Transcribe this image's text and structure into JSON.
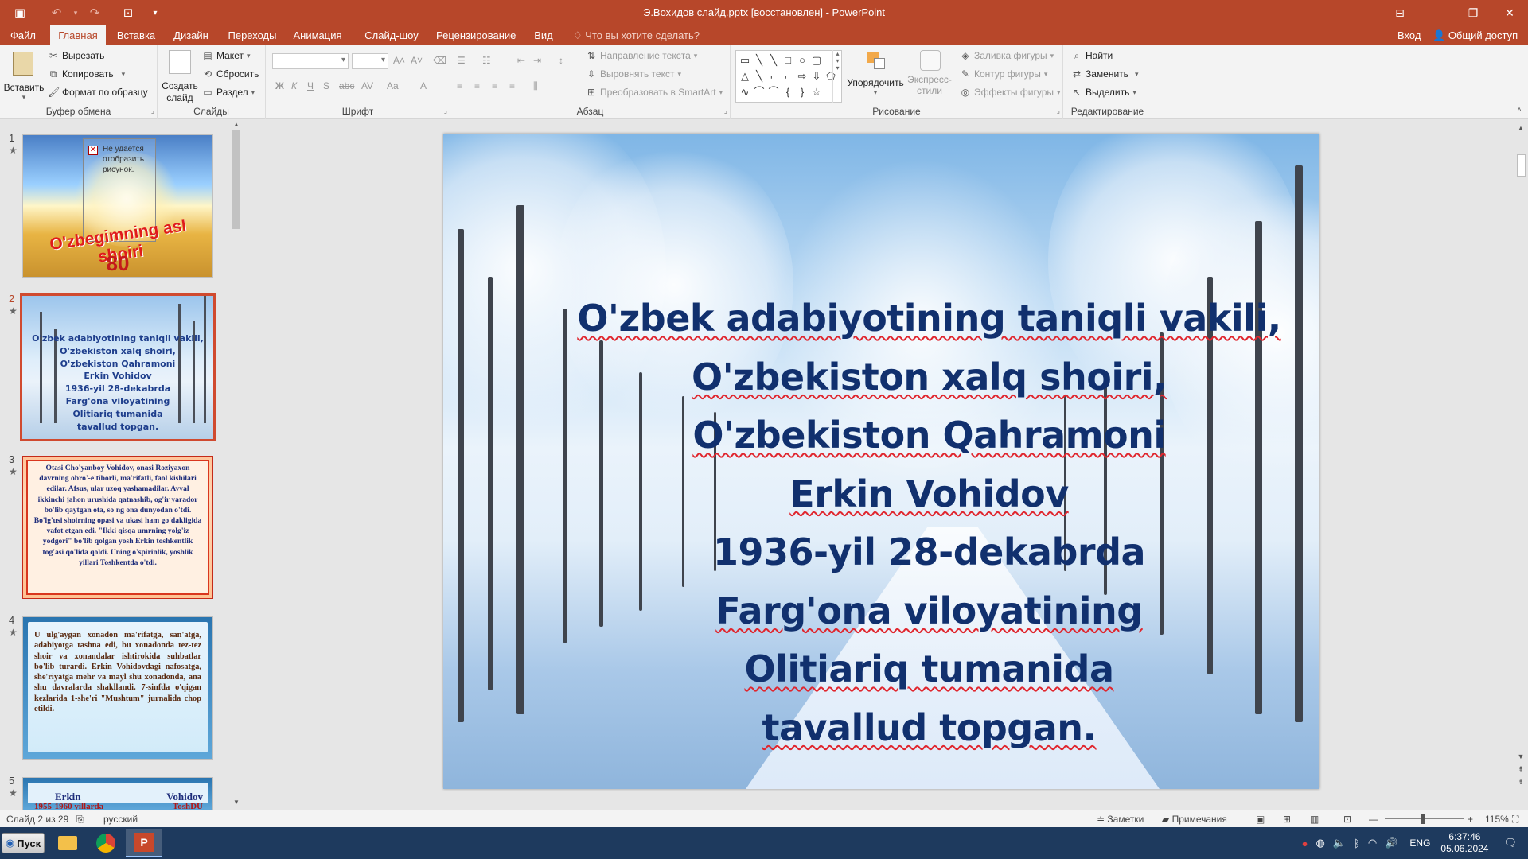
{
  "window": {
    "title": "Э.Вохидов слайд.pptx [восстановлен] - PowerPoint"
  },
  "tabs": [
    {
      "label": "Файл"
    },
    {
      "label": "Главная"
    },
    {
      "label": "Вставка"
    },
    {
      "label": "Дизайн"
    },
    {
      "label": "Переходы"
    },
    {
      "label": "Анимация"
    },
    {
      "label": "Слайд-шоу"
    },
    {
      "label": "Рецензирование"
    },
    {
      "label": "Вид"
    }
  ],
  "tell_me": "Что вы хотите сделать?",
  "account": {
    "sign_in": "Вход",
    "share": "Общий доступ"
  },
  "ribbon": {
    "clipboard": {
      "label": "Буфер обмена",
      "paste": "Вставить",
      "cut": "Вырезать",
      "copy": "Копировать",
      "format_painter": "Формат по образцу"
    },
    "slides": {
      "label": "Слайды",
      "new_slide_line1": "Создать",
      "new_slide_line2": "слайд",
      "layout": "Макет",
      "reset": "Сбросить",
      "section": "Раздел"
    },
    "font": {
      "label": "Шрифт",
      "family": "",
      "size": ""
    },
    "paragraph": {
      "label": "Абзац",
      "text_direction": "Направление текста",
      "align_text": "Выровнять текст",
      "smartart": "Преобразовать в SmartArt"
    },
    "drawing": {
      "label": "Рисование",
      "arrange": "Упорядочить",
      "quick_styles_line1": "Экспресс-",
      "quick_styles_line2": "стили",
      "shape_fill": "Заливка фигуры",
      "shape_outline": "Контур фигуры",
      "shape_effects": "Эффекты фигуры"
    },
    "editing": {
      "label": "Редактирование",
      "find": "Найти",
      "replace": "Заменить",
      "select": "Выделить"
    }
  },
  "thumbnails": [
    {
      "number": "1",
      "placeholder": "Не удается отобразить рисунок.",
      "title": "O'zbegimning asl shoiri",
      "subtitle": "80"
    },
    {
      "number": "2",
      "lines": [
        "O'zbek adabiyotining taniqli vakili,",
        "O'zbekiston xalq shoiri,",
        "O'zbekiston Qahramoni",
        "Erkin Vohidov",
        "1936-yil 28-dekabrda",
        "Farg'ona viloyatining",
        "Olitiariq tumanida",
        "tavallud topgan."
      ]
    },
    {
      "number": "3",
      "text": "Otasi Cho'yanboy Vohidov, onasi Roziyaxon davrning obro'-e'tiborli, ma'rifatli, faol kishilari edilar. Afsus, ular uzoq yashamadilar. Avval ikkinchi jahon urushida qatnashib, og'ir yarador bo'lib qaytgan ota, so'ng ona dunyodan o'tdi. Bo'lg'usi shoirning opasi va ukasi ham go'dakligida vafot etgan edi. \"Ikki qisqa umrning yolg'iz yodgori\" bo'lib qolgan yosh Erkin toshkentlik tog'asi qo'lida qoldi. Uning o'spirinlik, yoshlik yillari Toshkentda o'tdi."
    },
    {
      "number": "4",
      "text": "U ulg'aygan xonadon ma'rifatga, san'atga, adabiyotga tashna edi, bu xonadonda tez-tez shoir va xonandalar ishtirokida suhbatlar bo'lib turardi. Erkin Vohidovdagi nafosatga, she'riyatga mehr va mayl shu xonadonda, ana shu davralarda shakllandi. 7-sinfda o'qigan kezlarida 1-she'ri \"Mushtum\" jurnalida chop etildi."
    },
    {
      "number": "5",
      "line1a": "Erkin",
      "line1b": "Vohidov",
      "line2a": "1955-1960 yillarda",
      "line2b": "ToshDU"
    }
  ],
  "slide": {
    "lines": [
      "O'zbek adabiyotining taniqli vakili,",
      "O'zbekiston xalq shoiri,",
      "O'zbekiston Qahramoni",
      "Erkin Vohidov",
      "1936-yil 28-dekabrda",
      "Farg'ona viloyatining",
      "Olitiariq tumanida",
      "tavallud topgan."
    ],
    "text_color": "#11306e"
  },
  "status": {
    "slide_counter": "Слайд 2 из 29",
    "language": "русский",
    "notes": "Заметки",
    "comments": "Примечания",
    "zoom": "115%"
  },
  "taskbar": {
    "start": "Пуск",
    "lang": "ENG",
    "time": "6:37:46",
    "date": "05.06.2024"
  },
  "colors": {
    "accent": "#b7472a",
    "selection": "#d04a2f"
  }
}
